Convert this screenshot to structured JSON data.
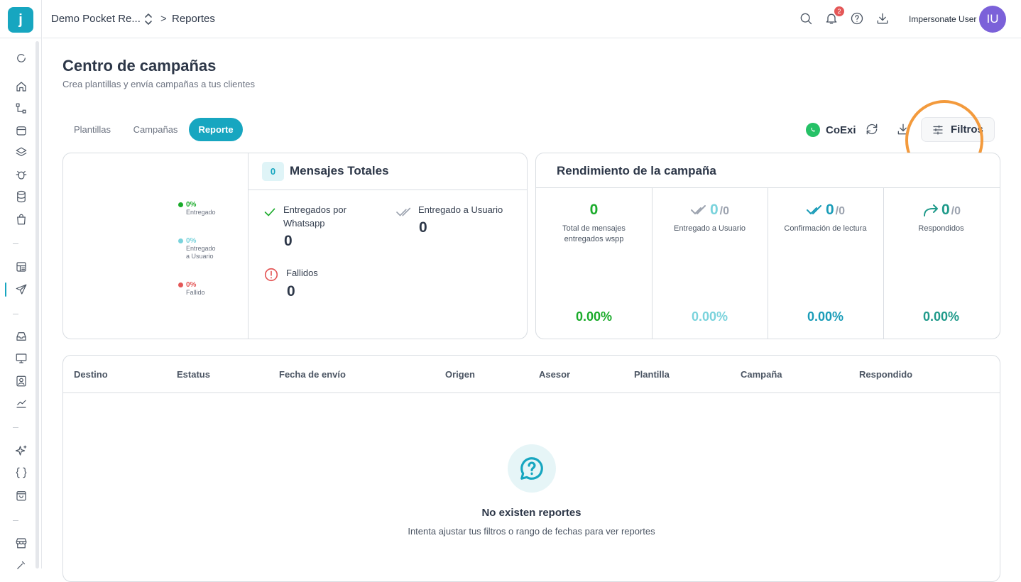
{
  "app": {
    "logo_letter": "j"
  },
  "header": {
    "workspace": "Demo Pocket Re...",
    "breadcrumb_sep": ">",
    "breadcrumb": "Reportes",
    "notifications_count": "2",
    "user_name": "Impersonate User",
    "avatar_initials": "IU"
  },
  "sidebar": {
    "items": [
      {
        "icon": "refresh-icon"
      },
      {
        "icon": "home-icon"
      },
      {
        "icon": "flow-icon"
      },
      {
        "icon": "archive-icon"
      },
      {
        "icon": "layers-icon"
      },
      {
        "icon": "bug-icon"
      },
      {
        "icon": "database-icon"
      },
      {
        "icon": "bag-icon"
      },
      {
        "icon": "layout-icon"
      },
      {
        "icon": "send-icon"
      },
      {
        "icon": "inbox-icon"
      },
      {
        "icon": "monitor-icon"
      },
      {
        "icon": "contact-icon"
      },
      {
        "icon": "chart-icon"
      },
      {
        "icon": "sparkles-icon"
      },
      {
        "icon": "braces-icon"
      },
      {
        "icon": "shop-bag-icon"
      },
      {
        "icon": "store-icon"
      }
    ],
    "active": "send-icon"
  },
  "page": {
    "title": "Centro de campañas",
    "subtitle": "Crea plantillas y envía campañas a tus clientes"
  },
  "tabs": [
    {
      "label": "Plantillas",
      "active": false
    },
    {
      "label": "Campañas",
      "active": false
    },
    {
      "label": "Reporte",
      "active": true
    }
  ],
  "toolbar": {
    "channel": "CoExi",
    "filter_label": "Filtros"
  },
  "summary": {
    "legend": [
      {
        "pct": "0%",
        "label": "Entregado",
        "color": "#1aab2a"
      },
      {
        "pct": "0%",
        "label": "Entregado a Usuario",
        "label_line1": "Entregado",
        "label_line2": "a Usuario",
        "color": "#7ad3dc"
      },
      {
        "pct": "0%",
        "label": "Fallido",
        "color": "#e45757"
      }
    ],
    "total_badge": "0",
    "total_title": "Mensajes Totales",
    "delivered_whatsapp_label_1": "Entregados por",
    "delivered_whatsapp_label_2": "Whatsapp",
    "delivered_whatsapp_value": "0",
    "delivered_user_label": "Entregado a Usuario",
    "delivered_user_value": "0",
    "failed_label": "Fallidos",
    "failed_value": "0"
  },
  "performance": {
    "title": "Rendimiento de la campaña",
    "metrics": [
      {
        "value": "0",
        "denominator": "",
        "label_1": "Total de mensajes",
        "label_2": "entregados wspp",
        "pct": "0.00%",
        "color": "#1aab2a"
      },
      {
        "value": "0",
        "denominator": "/0",
        "label_1": "Entregado a Usuario",
        "label_2": "",
        "pct": "0.00%",
        "color": "#7ad3dc"
      },
      {
        "value": "0",
        "denominator": "/0",
        "label_1": "Confirmación de lectura",
        "label_2": "",
        "pct": "0.00%",
        "color": "#1a9cb8"
      },
      {
        "value": "0",
        "denominator": "/0",
        "label_1": "Respondidos",
        "label_2": "",
        "pct": "0.00%",
        "color": "#1f9a8a"
      }
    ]
  },
  "table": {
    "columns": [
      "Destino",
      "Estatus",
      "Fecha de envío",
      "Origen",
      "Asesor",
      "Plantilla",
      "Campaña",
      "Respondido"
    ],
    "empty_title": "No existen reportes",
    "empty_subtitle": "Intenta ajustar tus filtros o rango de fechas para ver reportes"
  },
  "colors": {
    "accent": "#17a6c0",
    "highlight_ring": "#f39a3c"
  }
}
